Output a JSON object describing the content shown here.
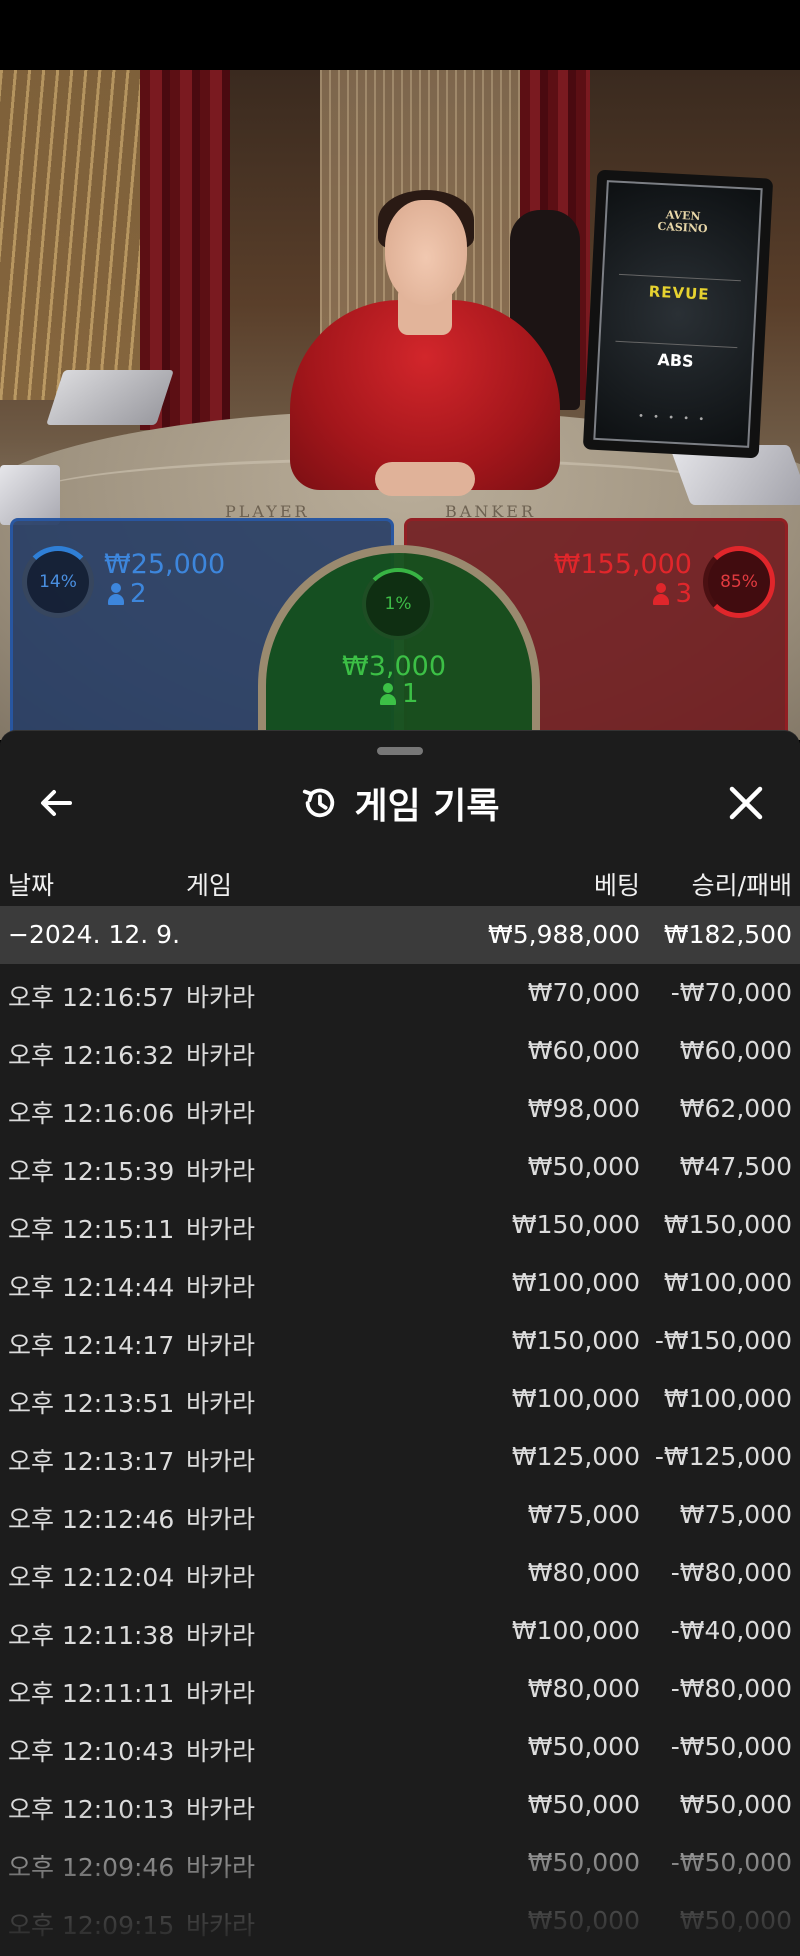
{
  "scene": {
    "felt_player": "PLAYER",
    "felt_banker": "BANKER",
    "monitor": {
      "line1": "AVEN",
      "line2": "CASINO",
      "revue": "REVUE",
      "abs": "ABS",
      "dots": "• • • • •"
    }
  },
  "bets": {
    "player": {
      "percent": "14%",
      "amount": "₩25,000",
      "count": "2",
      "color": "#3d86dc"
    },
    "tie": {
      "percent": "1%",
      "amount": "₩3,000",
      "count": "1",
      "color": "#3cc046"
    },
    "banker": {
      "percent": "85%",
      "amount": "₩155,000",
      "count": "3",
      "color": "#e0262b"
    }
  },
  "sheet": {
    "title": "게임 기록",
    "columns": {
      "date": "날짜",
      "game": "게임",
      "bet": "베팅",
      "result": "승리/패배"
    },
    "summary": {
      "date": "−2024. 12. 9.",
      "bet": "₩5,988,000",
      "result": "₩182,500"
    },
    "rows": [
      {
        "time": "오후 12:16:57",
        "game": "바카라",
        "bet": "₩70,000",
        "result": "-₩70,000"
      },
      {
        "time": "오후 12:16:32",
        "game": "바카라",
        "bet": "₩60,000",
        "result": "₩60,000"
      },
      {
        "time": "오후 12:16:06",
        "game": "바카라",
        "bet": "₩98,000",
        "result": "₩62,000"
      },
      {
        "time": "오후 12:15:39",
        "game": "바카라",
        "bet": "₩50,000",
        "result": "₩47,500"
      },
      {
        "time": "오후 12:15:11",
        "game": "바카라",
        "bet": "₩150,000",
        "result": "₩150,000"
      },
      {
        "time": "오후 12:14:44",
        "game": "바카라",
        "bet": "₩100,000",
        "result": "₩100,000"
      },
      {
        "time": "오후 12:14:17",
        "game": "바카라",
        "bet": "₩150,000",
        "result": "-₩150,000"
      },
      {
        "time": "오후 12:13:51",
        "game": "바카라",
        "bet": "₩100,000",
        "result": "₩100,000"
      },
      {
        "time": "오후 12:13:17",
        "game": "바카라",
        "bet": "₩125,000",
        "result": "-₩125,000"
      },
      {
        "time": "오후 12:12:46",
        "game": "바카라",
        "bet": "₩75,000",
        "result": "₩75,000"
      },
      {
        "time": "오후 12:12:04",
        "game": "바카라",
        "bet": "₩80,000",
        "result": "-₩80,000"
      },
      {
        "time": "오후 12:11:38",
        "game": "바카라",
        "bet": "₩100,000",
        "result": "-₩40,000"
      },
      {
        "time": "오후 12:11:11",
        "game": "바카라",
        "bet": "₩80,000",
        "result": "-₩80,000"
      },
      {
        "time": "오후 12:10:43",
        "game": "바카라",
        "bet": "₩50,000",
        "result": "-₩50,000"
      },
      {
        "time": "오후 12:10:13",
        "game": "바카라",
        "bet": "₩50,000",
        "result": "₩50,000"
      },
      {
        "time": "오후 12:09:46",
        "game": "바카라",
        "bet": "₩50,000",
        "result": "-₩50,000"
      },
      {
        "time": "오후 12:09:15",
        "game": "바카라",
        "bet": "₩50,000",
        "result": "₩50,000"
      }
    ]
  }
}
